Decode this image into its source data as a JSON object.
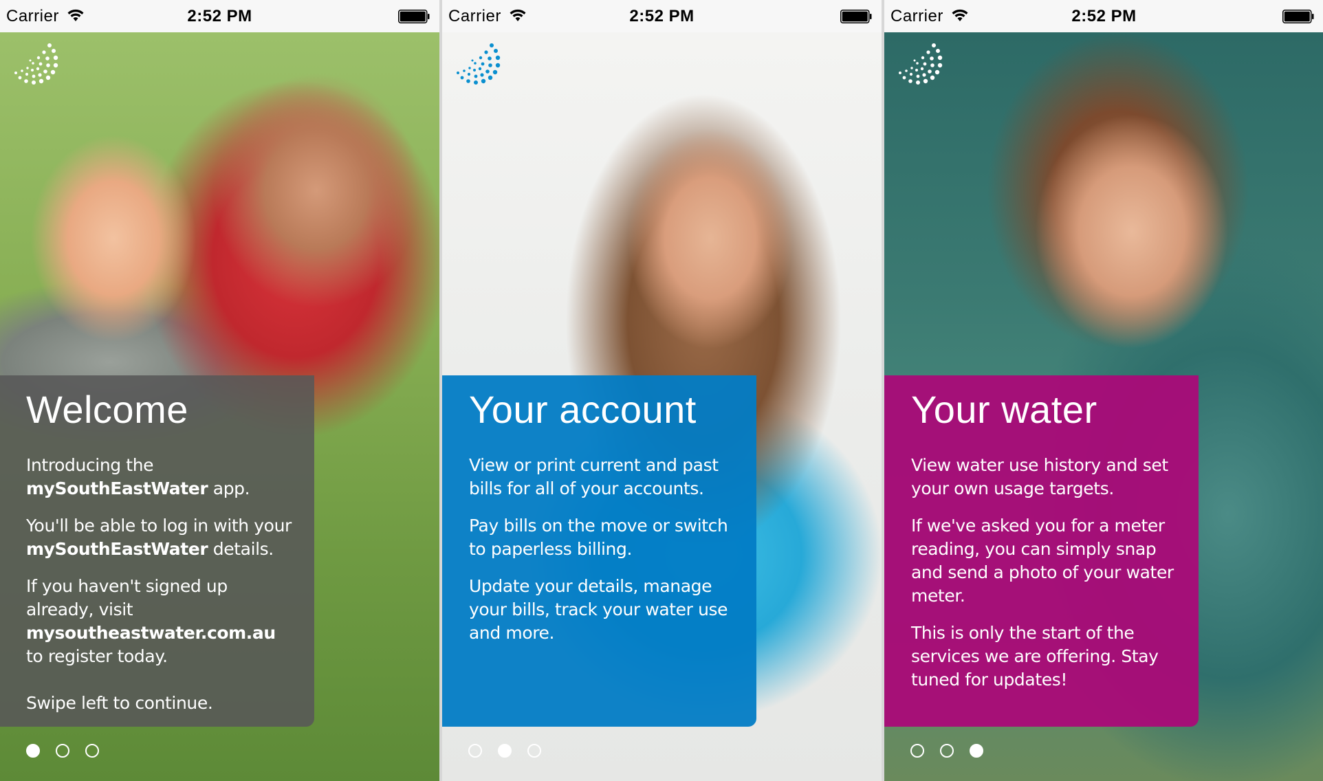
{
  "status_bar": {
    "carrier": "Carrier",
    "time": "2:52 PM",
    "wifi_icon": "wifi-icon",
    "battery_icon": "battery-icon"
  },
  "screens": [
    {
      "title": "Welcome",
      "card_color": "#585858",
      "logo_color": "#ffffff",
      "paragraphs": [
        {
          "prefix": "Introducing the ",
          "bold": "mySouthEastWater",
          "suffix": " app."
        },
        {
          "prefix": "You'll be able to log in with your ",
          "bold": "mySouthEastWater",
          "suffix": " details."
        },
        {
          "prefix": "If you haven't signed up already, visit ",
          "bold": "mysoutheastwater.com.au",
          "suffix": " to register today."
        }
      ],
      "swipe_hint": "Swipe left to continue.",
      "active_page": 1
    },
    {
      "title": "Your account",
      "card_color": "#027cc5",
      "logo_color": "#0a8fcf",
      "paragraphs": [
        "View or print current and past bills for all of your accounts.",
        "Pay bills on the move or switch to paperless billing.",
        "Update your details, manage your bills, track your water use and more."
      ],
      "active_page": 2
    },
    {
      "title": "Your water",
      "card_color": "#aa0978",
      "logo_color": "#ffffff",
      "paragraphs": [
        "View water use history and set your own usage targets.",
        "If we've asked you for a meter reading, you can simply snap and send a photo of your water meter.",
        "This is only the start of the services we are offering. Stay tuned for updates!"
      ],
      "active_page": 3
    }
  ],
  "page_count": 3
}
